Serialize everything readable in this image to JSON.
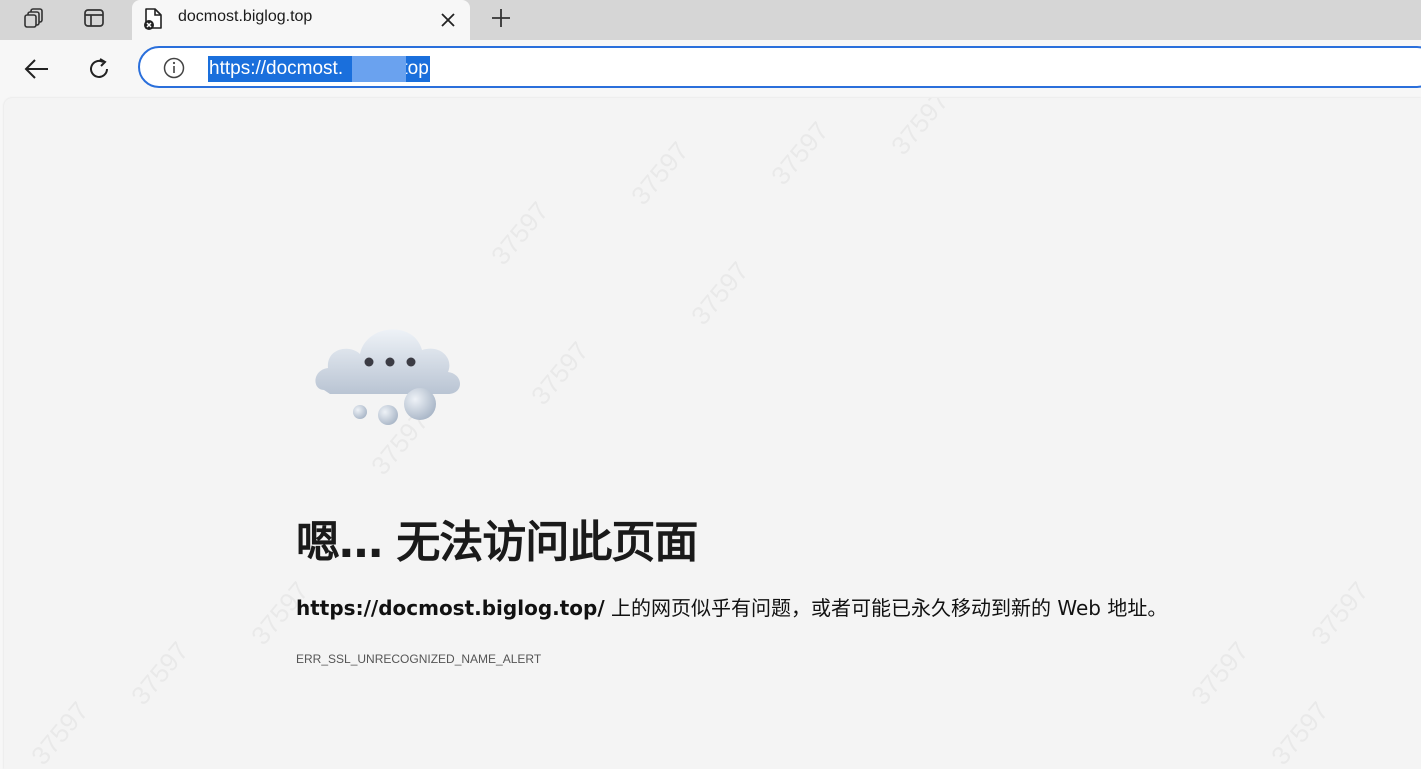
{
  "tab": {
    "title": "docmost.biglog.top",
    "favicon": "error-page-icon",
    "close_glyph": "✕",
    "new_tab_glyph": "+"
  },
  "toolbar": {
    "url": "https://docmost.biglog.top",
    "url_visible_start": "https://docmost.",
    "url_visible_end": ".top"
  },
  "error": {
    "heading": "嗯… 无法访问此页面",
    "url": "https://docmost.biglog.top/",
    "description": " 上的网页似乎有问题，或者可能已永久移动到新的 Web 地址。",
    "code": "ERR_SSL_UNRECOGNIZED_NAME_ALERT"
  },
  "colors": {
    "accent": "#1a6fdc",
    "address_border": "#2a6fdb",
    "page_bg": "#f4f4f4"
  }
}
